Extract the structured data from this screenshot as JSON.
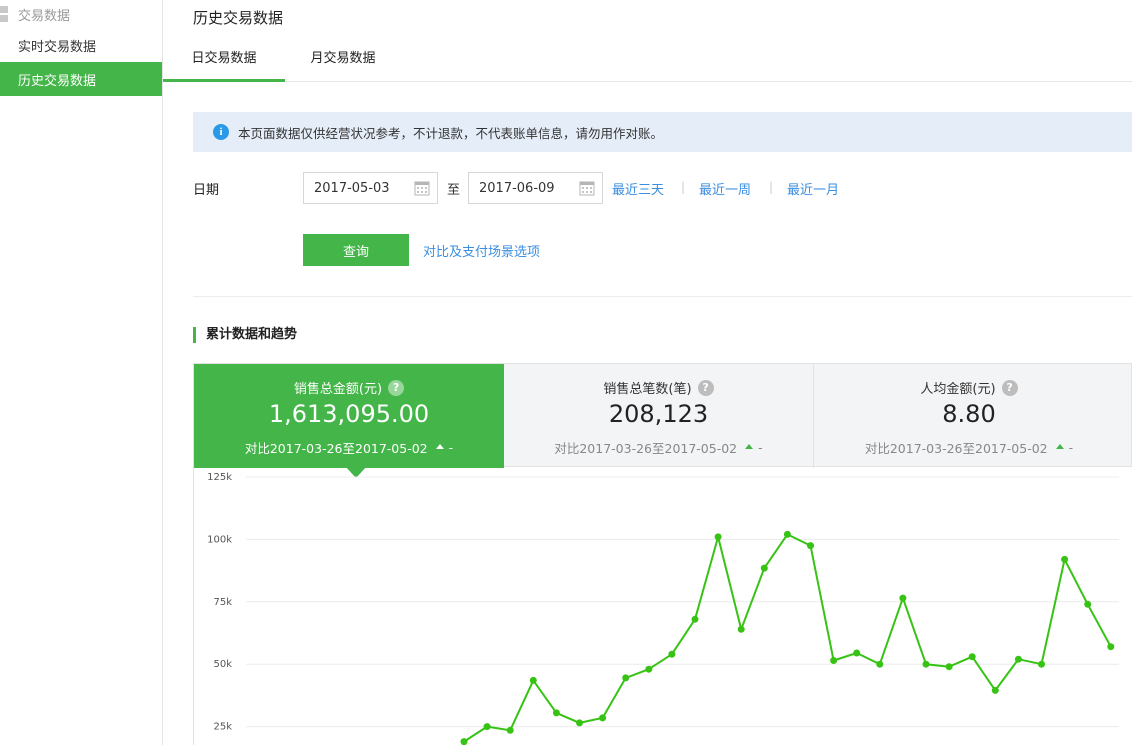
{
  "sidebar": {
    "group_label": "交易数据",
    "items": [
      {
        "label": "实时交易数据",
        "active": false
      },
      {
        "label": "历史交易数据",
        "active": true
      }
    ]
  },
  "header": {
    "title": "历史交易数据",
    "tabs": [
      {
        "label": "日交易数据",
        "active": true
      },
      {
        "label": "月交易数据",
        "active": false
      }
    ]
  },
  "notice": {
    "text": "本页面数据仅供经营状况参考，不计退款，不代表账单信息，请勿用作对账。"
  },
  "filter": {
    "date_label": "日期",
    "start_date": "2017-05-03",
    "to_label": "至",
    "end_date": "2017-06-09",
    "quick_ranges": [
      "最近三天",
      "最近一周",
      "最近一月"
    ],
    "separator": "|",
    "query_label": "查询",
    "compare_link": "对比及支付场景选项"
  },
  "section": {
    "title": "累计数据和趋势"
  },
  "stats": [
    {
      "label": "销售总金额(元)",
      "value": "1,613,095.00",
      "compare": "对比2017-03-26至2017-05-02",
      "change": "-",
      "selected": true
    },
    {
      "label": "销售总笔数(笔)",
      "value": "208,123",
      "compare": "对比2017-03-26至2017-05-02",
      "change": "-",
      "selected": false
    },
    {
      "label": "人均金额(元)",
      "value": "8.80",
      "compare": "对比2017-03-26至2017-05-02",
      "change": "-",
      "selected": false
    }
  ],
  "colors": {
    "accent": "#44b549",
    "link": "#3a8ee0",
    "info": "#2a9ae8",
    "line": "#37c314"
  },
  "icons": {
    "info": "info-icon",
    "help": "question-circle-icon",
    "calendar": "calendar-icon",
    "trend": "arrow-up-icon"
  },
  "chart_data": {
    "type": "line",
    "title": "",
    "xlabel": "",
    "ylabel": "",
    "ylim": [
      0,
      125000
    ],
    "yticks": [
      "25k",
      "50k",
      "75k",
      "100k",
      "125k"
    ],
    "grid": true,
    "series": [
      {
        "values": [
          19000,
          25000,
          23500,
          43500,
          30500,
          26500,
          28500,
          44500,
          48000,
          54000,
          68000,
          101000,
          64000,
          88500,
          102000,
          97500,
          51500,
          54500,
          50000,
          76500,
          50000,
          49000,
          53000,
          39500,
          52000,
          50000,
          92000,
          74000,
          57000
        ]
      }
    ]
  }
}
